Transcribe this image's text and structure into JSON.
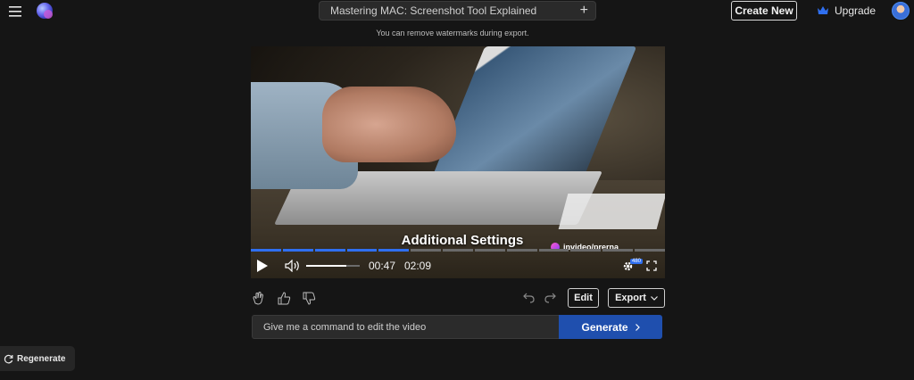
{
  "header": {
    "project_title": "Mastering MAC: Screenshot Tool Explained",
    "create_new_label": "Create New",
    "upgrade_label": "Upgrade",
    "watermark_note": "You can remove watermarks during export."
  },
  "player": {
    "caption": "Additional Settings",
    "creator_handle": "invideo/prerna",
    "current_time": "00:47",
    "total_time": "02:09",
    "resolution_badge": "480",
    "progress_segments_played": 5,
    "progress_segments_total": 13,
    "volume_fraction": 0.75
  },
  "actions": {
    "edit_label": "Edit",
    "export_label": "Export"
  },
  "command": {
    "placeholder": "Give me a command to edit the video",
    "generate_label": "Generate"
  },
  "footer": {
    "regenerate_label": "Regenerate"
  },
  "colors": {
    "background": "#151515",
    "accent_blue": "#1f4fae",
    "progress_blue": "#2f6ff0"
  }
}
